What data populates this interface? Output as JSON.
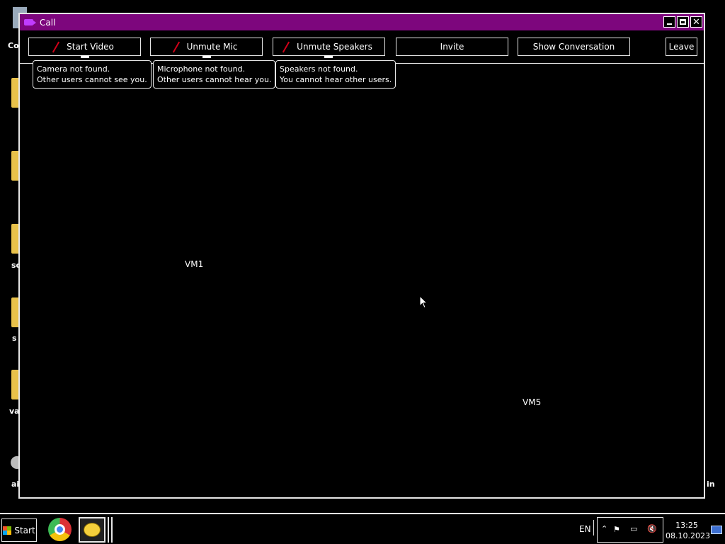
{
  "window": {
    "title": "Call"
  },
  "toolbar": {
    "start_video": "Start Video",
    "unmute_mic": "Unmute Mic",
    "unmute_speakers": "Unmute Speakers",
    "invite": "Invite",
    "show_conversation": "Show Conversation",
    "leave": "Leave"
  },
  "tooltips": {
    "camera": [
      "Camera not found.",
      "Other users cannot see you."
    ],
    "microphone": [
      "Microphone not found.",
      "Other users cannot hear you."
    ],
    "speakers": [
      "Speakers not found.",
      "You cannot hear other users."
    ]
  },
  "participants": [
    "VM1",
    "VM5"
  ],
  "desktop_labels": [
    "Co",
    "sc",
    "s",
    "va",
    "ai",
    "in"
  ],
  "taskbar": {
    "start_label": "Start",
    "language": "EN",
    "time": "13:25",
    "date": "08.10.2023"
  },
  "colors": {
    "titlebar": "#7d067d",
    "muted_slash": "#d00018"
  }
}
